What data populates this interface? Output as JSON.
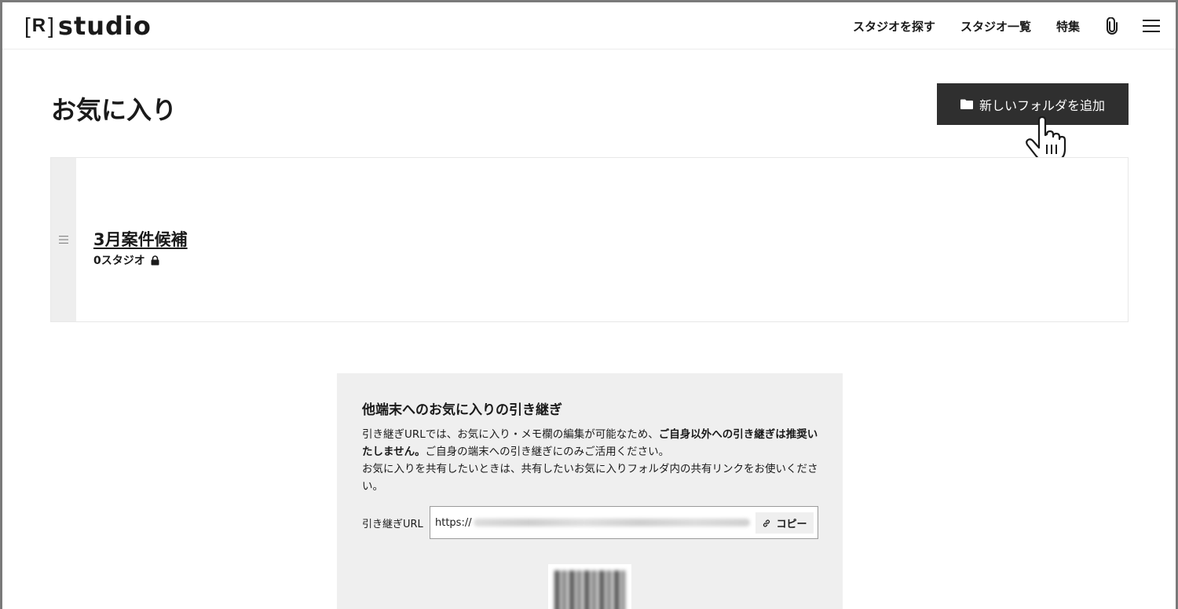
{
  "header": {
    "logo": {
      "bracket_left": "[",
      "letter": "R",
      "bracket_right": "]",
      "word": "studio"
    },
    "nav": [
      {
        "label": "スタジオを探す"
      },
      {
        "label": "スタジオ一覧"
      },
      {
        "label": "特集"
      }
    ],
    "icons": [
      "paperclip-icon",
      "hamburger-menu-icon"
    ]
  },
  "page": {
    "title": "お気に入り",
    "add_folder_label": "新しいフォルダを追加"
  },
  "folders": [
    {
      "name": "3月案件候補",
      "count_label": "0スタジオ",
      "private": true
    }
  ],
  "transfer": {
    "title": "他端末へのお気に入りの引き継ぎ",
    "text_1": "引き継ぎURLでは、お気に入り・メモ欄の編集が可能なため、",
    "text_1_bold": "ご自身以外への引き継ぎは推奨いたしません。",
    "text_2": "ご自身の端末への引き継ぎにのみご活用ください。",
    "text_3": "お気に入りを共有したいときは、共有したいお気に入りフォルダ内の共有リンクをお使いください。",
    "url_label": "引き継ぎURL",
    "url_prefix": "https://",
    "copy_label": "コピー"
  },
  "colors": {
    "dark_button": "#2f2f2f",
    "panel_bg": "#efefef",
    "handle_bg": "#eeeeee"
  }
}
